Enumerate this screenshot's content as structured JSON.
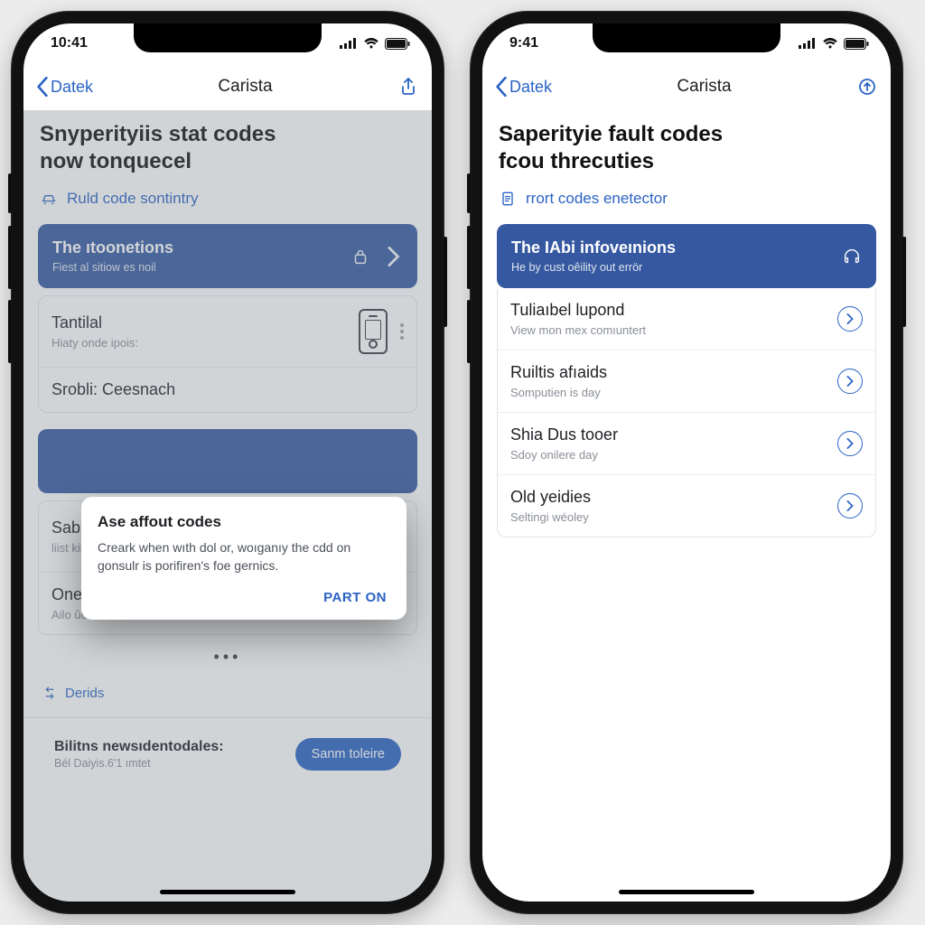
{
  "colors": {
    "accent": "#2a63c4",
    "cardBlue": "#3558a0"
  },
  "left": {
    "status": {
      "time": "10:41"
    },
    "nav": {
      "back": "Datek",
      "title": "Carista"
    },
    "hero": {
      "line1": "Snyperityiis stat codes",
      "line2": "now tonquecel"
    },
    "subaction": "Ruld code sontintry",
    "feature": {
      "title": "The ıtoonetions",
      "subtitle": "Fiest al sitiow es noil"
    },
    "rows": {
      "a": {
        "title": "Tantilal",
        "subtitle": "Hiaty onde ipois:"
      },
      "b": {
        "title": "Srobli: Ceesnach"
      },
      "c": {
        "title": "Sabint Berecteal",
        "subtitle": "liist kiin peınerliey"
      },
      "d": {
        "title": "Onener shoutororf",
        "subtitle": "Ailo ûciióler veatiorn"
      }
    },
    "footer_link": "Derids",
    "news": {
      "title": "Bilitns newsıdentodales:",
      "subtitle": "Bél Daiyis.6'1 ımtet"
    },
    "cta": "Sanm toleire",
    "modal": {
      "title": "Ase affout codes",
      "body": "Creark when wıth dol or, woıganıy the cdd on gonsulr is porifiren's foe gernics.",
      "action": "PART ON"
    }
  },
  "right": {
    "status": {
      "time": "9:41"
    },
    "nav": {
      "back": "Datek",
      "title": "Carista"
    },
    "hero": {
      "line1": "Saperityie fault codes",
      "line2": "fcou threcuties"
    },
    "subaction": "rrort codes enetector",
    "feature": {
      "title": "The IAbi infoveınions",
      "subtitle": "He by cust oêility out errör"
    },
    "rows": {
      "a": {
        "title": "Tuliaıbel lupond",
        "subtitle": "View mon mex comıuntert"
      },
      "b": {
        "title": "Ruiltis afıaids",
        "subtitle": "Somputien is day"
      },
      "c": {
        "title": "Shia Dus tooer",
        "subtitle": "Sdoy onilere day"
      },
      "d": {
        "title": "Old yeidies",
        "subtitle": "Seltingi wéoley"
      }
    }
  }
}
